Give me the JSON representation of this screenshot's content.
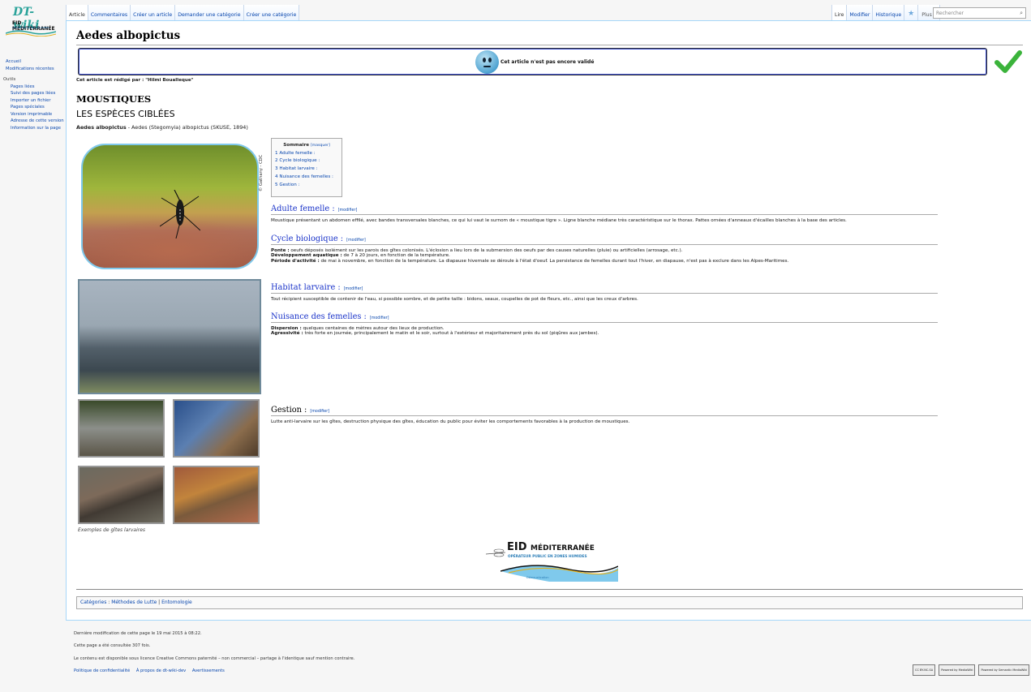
{
  "logo": {
    "name": "DT-wiki",
    "org": "EID MÉDITERRANÉE",
    "tagline": "OPÉRATEUR PUBLIC EN ZONES HUMIDES"
  },
  "nav": {
    "main": [
      "Accueil",
      "Modifications récentes"
    ],
    "tools_heading": "Outils",
    "tools": [
      "Pages liées",
      "Suivi des pages liées",
      "Importer un fichier",
      "Pages spéciales",
      "Version imprimable",
      "Adresse de cette version",
      "Information sur la page"
    ]
  },
  "tabs_left": [
    "Article",
    "Commentaires",
    "Créer un article",
    "Demander une catégorie",
    "Créer une catégorie"
  ],
  "tabs_right": [
    "Lire",
    "Modifier",
    "Historique"
  ],
  "more_label": "Plus",
  "search_placeholder": "Rechercher",
  "page": {
    "title": "Aedes albopictus",
    "validation": "Cet article n'est pas encore validé",
    "author": "Cet article est rédigé par : \"Hilmi Boualleque\"",
    "h_moustiques": "MOUSTIQUES",
    "h_especes": "LES ESPÈCES CIBLÉES",
    "species_bold": "Aedes albopictus",
    "species_rest": " - Aedes (Stegomyia) albopictus (SKUSE, 1894)",
    "photo_credit": "© Gathany - CDC",
    "gites_caption": "Exemples de gîtes larvaires"
  },
  "toc": {
    "title": "Sommaire",
    "toggle": "[masquer]",
    "items": [
      "1 Adulte femelle :",
      "2 Cycle biologique :",
      "3 Habitat larvaire :",
      "4 Nuisance des femelles :",
      "5 Gestion :"
    ]
  },
  "edit_label": "[modifier]",
  "sections": {
    "s1": {
      "title": "Adulte femelle :",
      "text": "Moustique présentant un abdomen effilé, avec bandes transversales blanches, ce qui lui vaut le surnom de « moustique tigre ». Ligne blanche médiane très caractéristique sur le thorax. Pattes ornées d'anneaux d'écailles blanches à la base des articles."
    },
    "s2": {
      "title": "Cycle biologique :",
      "l1b": "Ponte :",
      "l1": " oeufs déposés isolément sur les parois des gîtes colonisés. L'éclosion a lieu lors de la submersion des oeufs par des causes naturelles (pluie) ou artificielles (arrosage, etc.).",
      "l2b": "Développement aquatique :",
      "l2": " de 7 à 20 jours, en fonction de la température.",
      "l3b": "Période d'activité :",
      "l3": " de mai à novembre, en fonction de la température. La diapause hivernale se déroule à l'état d'oeuf. La persistance de femelles durant tout l'hiver, en diapause, n'est pas à exclure dans les Alpes-Maritimes."
    },
    "s3": {
      "title": "Habitat larvaire :",
      "text": "Tout récipient susceptible de contenir de l'eau, si possible sombre, et de petite taille : bidons, seaux, coupelles de pot de fleurs, etc., ainsi que les creux d'arbres."
    },
    "s4": {
      "title": "Nuisance des femelles :",
      "l1b": "Dispersion :",
      "l1": " quelques centaines de mètres autour des lieux de production.",
      "l2b": "Agressivité :",
      "l2": " très forte en journée, principalement le matin et le soir, surtout à l'extérieur et majoritairement près du sol (piqûres aux jambes)."
    },
    "s5": {
      "title": "Gestion :",
      "text": "Lutte anti-larvaire sur les gîtes, destruction physique des gîtes, éducation du public pour éviter les comportements favorables à la production de moustiques."
    }
  },
  "bottom_logo": {
    "main": "EID",
    "main2": "MÉDITERRANÉE",
    "sub": "OPÉRATEUR PUBLIC EN ZONES HUMIDES",
    "tag": "Démoustication"
  },
  "categories": {
    "label": "Catégories",
    "items": [
      "Méthodes de Lutte",
      "Entomologie"
    ]
  },
  "footer": {
    "modified": "Dernière modification de cette page le 19 mai 2015 à 08:22.",
    "views": "Cette page a été consultée 307 fois.",
    "license": "Le contenu est disponible sous licence Creative Commons paternité – non commercial – partage à l'identique sauf mention contraire.",
    "links": [
      "Politique de confidentialité",
      "À propos de dt-wiki-dev",
      "Avertissements"
    ],
    "icons": [
      "CC BY-NC-SA",
      "Powered by MediaWiki",
      "Powered by Semantic MediaWiki"
    ]
  },
  "colors": {
    "link": "#0645ad",
    "heading": "#1a33c9",
    "border": "#a7d7f9"
  }
}
